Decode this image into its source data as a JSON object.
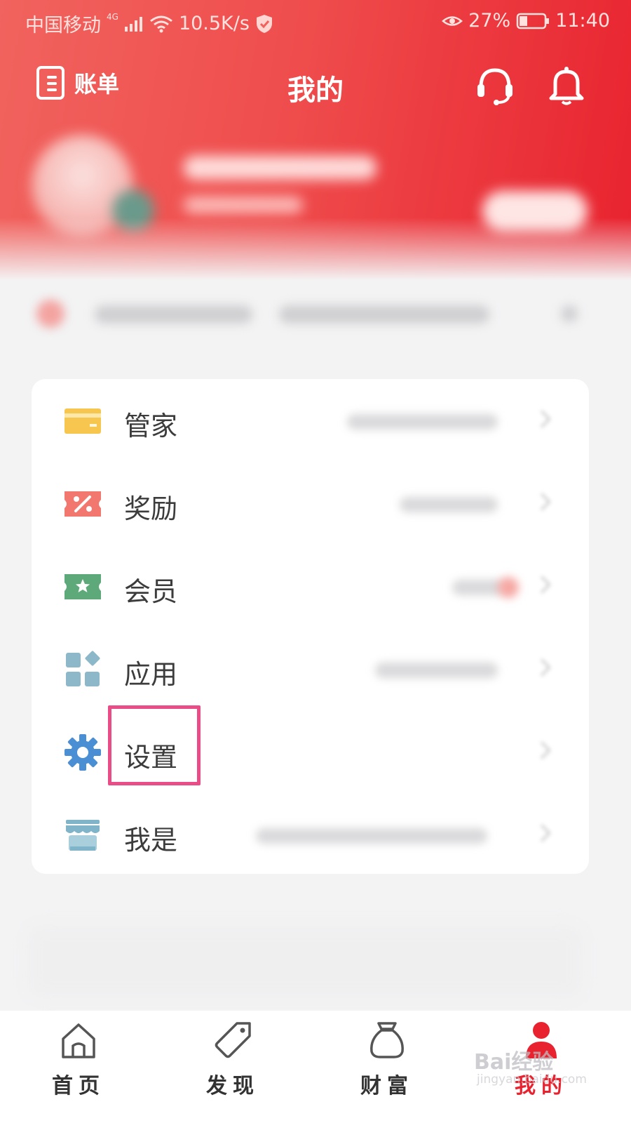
{
  "status_bar": {
    "carrier": "中国移动",
    "network": "4G",
    "speed": "10.5K/s",
    "battery": "27%",
    "time": "11:40"
  },
  "header": {
    "bill_label": "账单",
    "title": "我的"
  },
  "menu": {
    "items": [
      {
        "label": "管家",
        "icon": "card-icon"
      },
      {
        "label": "奖励",
        "icon": "coupon-icon"
      },
      {
        "label": "会员",
        "icon": "member-ticket-icon"
      },
      {
        "label": "应用",
        "icon": "apps-grid-icon"
      },
      {
        "label": "设置",
        "icon": "gear-icon"
      },
      {
        "label": "我是",
        "icon": "shop-icon"
      }
    ]
  },
  "tabs": [
    {
      "label": "首页",
      "icon": "home-icon",
      "active": false
    },
    {
      "label": "发现",
      "icon": "tag-icon",
      "active": false
    },
    {
      "label": "财富",
      "icon": "money-bag-icon",
      "active": false
    },
    {
      "label": "我的",
      "icon": "person-icon",
      "active": true
    }
  ],
  "watermark": {
    "brand": "Bai经验",
    "url": "jingyan.baidu.com"
  },
  "colors": {
    "header_red": "#e8232f",
    "highlight_pink": "#e94c86",
    "card_yellow": "#f7c64e",
    "coupon_red": "#f2786f",
    "member_green": "#5ea97a",
    "apps_blue": "#8db8ca",
    "gear_blue": "#4a8fd4",
    "shop_blue": "#7fb4c9"
  }
}
